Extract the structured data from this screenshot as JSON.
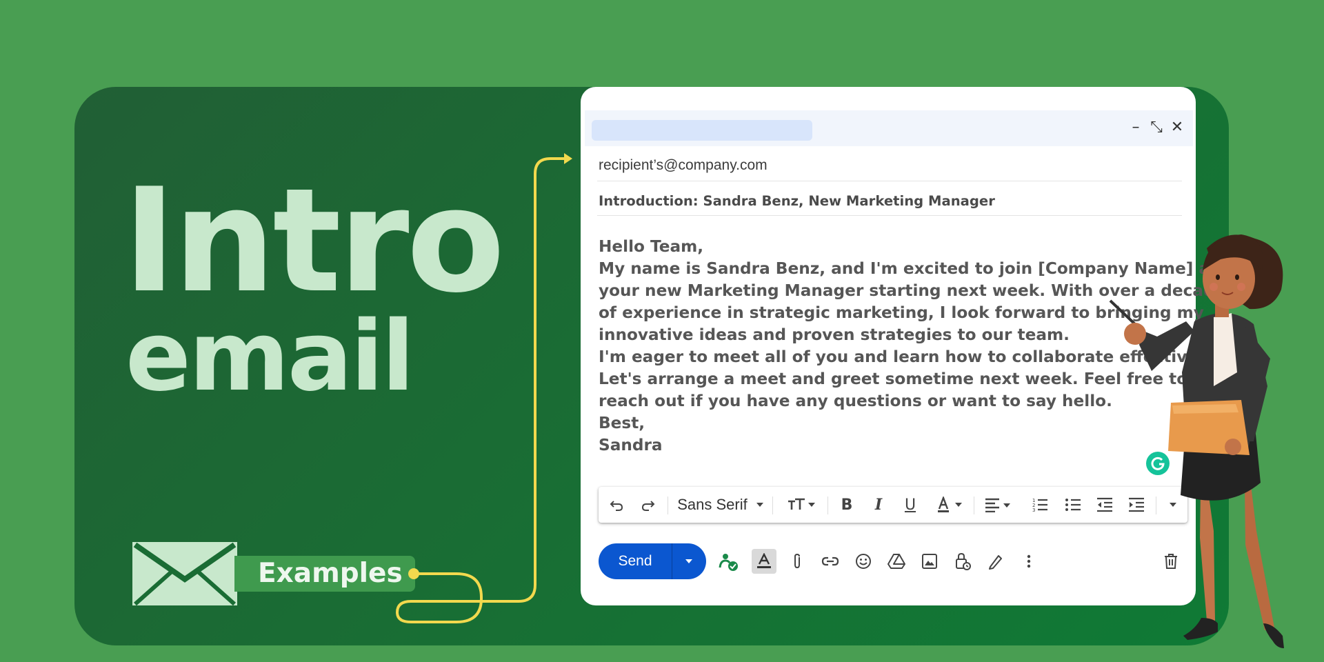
{
  "banner": {
    "title_line1": "Intro",
    "title_line2": "email",
    "examples_label": "Examples"
  },
  "compose": {
    "to": "recipient’s@company.com",
    "subject": "Introduction: Sandra Benz, New Marketing Manager",
    "body_lines": [
      "Hello Team,",
      "My name is Sandra Benz, and I'm excited to join [Company Name] as",
      "your new Marketing Manager starting next week. With over a decade",
      "of experience in strategic marketing, I look forward to bringing my",
      "innovative ideas and proven strategies to our team.",
      "I'm eager to meet all of you and learn how to collaborate effectively.",
      "Let's arrange a meet and greet sometime next week. Feel free to",
      "reach out if you have any questions or want to say hello.",
      "Best,",
      "Sandra"
    ],
    "window_controls": {
      "minimize": "–",
      "exit_fullscreen": "⤡",
      "close": "✕"
    },
    "toolbar": {
      "font_name": "Sans Serif",
      "icons": [
        "undo-icon",
        "redo-icon",
        "font-select",
        "font-size-icon",
        "bold-icon",
        "italic-icon",
        "underline-icon",
        "text-color-icon",
        "align-icon",
        "numbered-list-icon",
        "bulleted-list-icon",
        "indent-less-icon",
        "indent-more-icon",
        "more-formatting-icon"
      ]
    },
    "send_label": "Send",
    "actions": [
      "smart-compose-icon",
      "formatting-toggle-icon",
      "attach-icon",
      "link-icon",
      "emoji-icon",
      "drive-icon",
      "photo-icon",
      "confidential-icon",
      "signature-icon",
      "more-options-icon",
      "discard-icon"
    ]
  },
  "colors": {
    "background": "#499e52",
    "card": "#1a6c34",
    "title": "#c8e8cc",
    "send": "#0b57d0",
    "connector": "#f2d94e",
    "grammarly": "#15c39a"
  }
}
